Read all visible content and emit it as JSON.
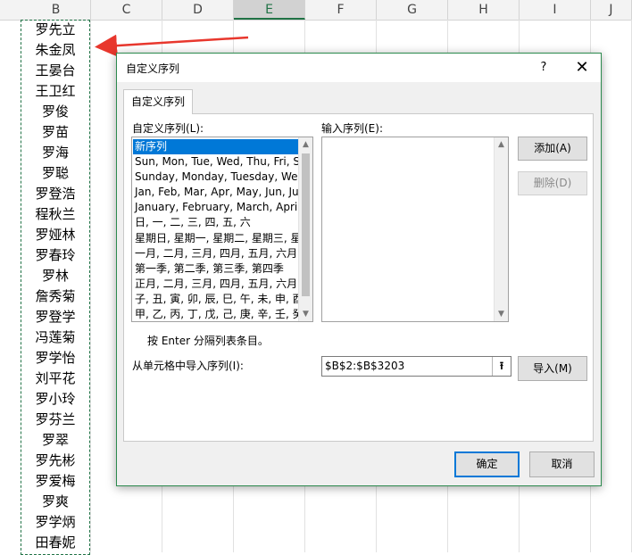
{
  "sheet": {
    "columns": [
      "B",
      "C",
      "D",
      "E",
      "F",
      "G",
      "H",
      "I",
      "J"
    ],
    "selected_column": "E",
    "cells_b": [
      "罗先立",
      "朱金凤",
      "王晏台",
      "王卫红",
      "罗俊",
      "罗苗",
      "罗海",
      "罗聪",
      "罗登浩",
      "程秋兰",
      "罗娅林",
      "罗春玲",
      "罗林",
      "詹秀菊",
      "罗登学",
      "冯莲菊",
      "罗学怡",
      "刘平花",
      "罗小玲",
      "罗芬兰",
      "罗翠",
      "罗先彬",
      "罗爱梅",
      "罗爽",
      "罗学炳",
      "田春妮"
    ]
  },
  "dialog": {
    "title": "自定义序列",
    "help": "?",
    "close": "✕",
    "tab": "自定义序列",
    "list_label": "自定义序列(L):",
    "entries_label": "输入序列(E):",
    "list_items": [
      "新序列",
      "Sun, Mon, Tue, Wed, Thu, Fri, Sat",
      "Sunday, Monday, Tuesday, Wednesday",
      "Jan, Feb, Mar, Apr, May, Jun, Jul",
      "January, February, March, April,",
      "日, 一, 二, 三, 四, 五, 六",
      "星期日, 星期一, 星期二, 星期三, 星期四",
      "一月, 二月, 三月, 四月, 五月, 六月,",
      "第一季, 第二季, 第三季, 第四季",
      "正月, 二月, 三月, 四月, 五月, 六月,",
      "子, 丑, 寅, 卯, 辰, 巳, 午, 未, 申, 酉",
      "甲, 乙, 丙, 丁, 戊, 己, 庚, 辛, 壬, 癸"
    ],
    "add_button": "添加(A)",
    "delete_button": "删除(D)",
    "hint": "按 Enter 分隔列表条目。",
    "import_label": "从单元格中导入序列(I):",
    "import_value": "$B$2:$B$3203",
    "import_button": "导入(M)",
    "ok_button": "确定",
    "cancel_button": "取消",
    "accent_color": "#217346",
    "selection_color": "#0078d7",
    "arrow_color": "#e8372d"
  }
}
